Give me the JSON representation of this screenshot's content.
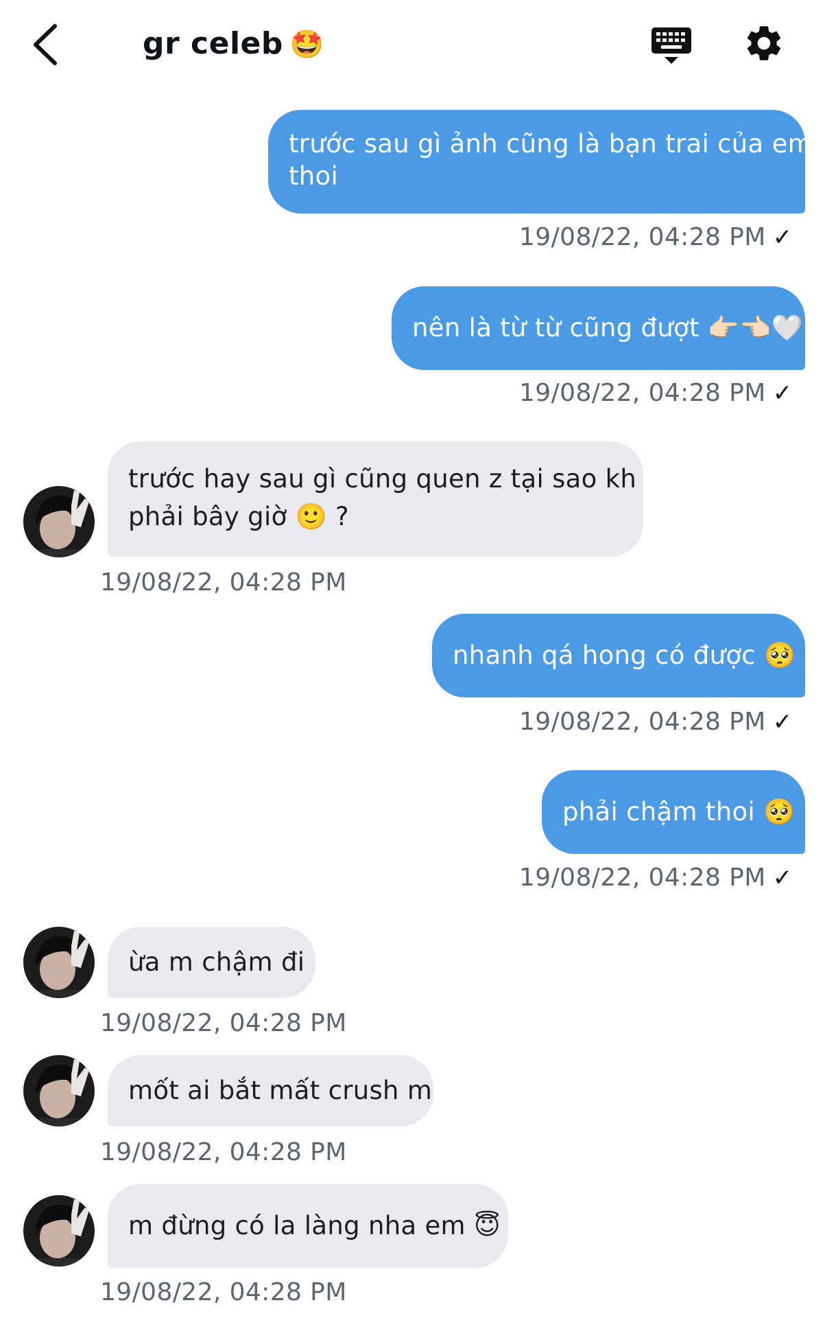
{
  "header": {
    "title": "gr celeb",
    "title_emoji": "🤩",
    "back_icon": "chevron-left-icon",
    "keyboard_icon": "keyboard-icon",
    "settings_icon": "gear-icon"
  },
  "colors": {
    "outgoing_bubble": "#4a9ae6",
    "incoming_bubble": "#e8eaee",
    "timestamp": "#5b6570"
  },
  "messages": [
    {
      "direction": "out",
      "lines": [
        "trước sau gì ảnh cũng là bạn trai của em",
        "thoi"
      ],
      "timestamp": "19/08/22, 04:28 PM",
      "read_mark": "✓"
    },
    {
      "direction": "out",
      "lines": [
        "nên là từ từ cũng đượt 👉🏻👈🏻🤍"
      ],
      "timestamp": "19/08/22, 04:28 PM",
      "read_mark": "✓"
    },
    {
      "direction": "in",
      "lines": [
        "trước hay sau gì cũng quen z tại sao kh",
        "phải bây giờ 🙂 ?"
      ],
      "timestamp": "19/08/22, 04:28 PM"
    },
    {
      "direction": "out",
      "lines": [
        "nhanh qá hong có được 🥺"
      ],
      "timestamp": "19/08/22, 04:28 PM",
      "read_mark": "✓"
    },
    {
      "direction": "out",
      "lines": [
        "phải chậm thoi 🥺"
      ],
      "timestamp": "19/08/22, 04:28 PM",
      "read_mark": "✓"
    },
    {
      "direction": "in",
      "lines": [
        "ừa m chậm đi"
      ],
      "timestamp": "19/08/22, 04:28 PM"
    },
    {
      "direction": "in",
      "lines": [
        "mốt ai bắt mất crush m"
      ],
      "timestamp": "19/08/22, 04:28 PM"
    },
    {
      "direction": "in",
      "lines": [
        "m đừng có la làng nha em 😇"
      ],
      "timestamp": "19/08/22, 04:28 PM"
    }
  ]
}
